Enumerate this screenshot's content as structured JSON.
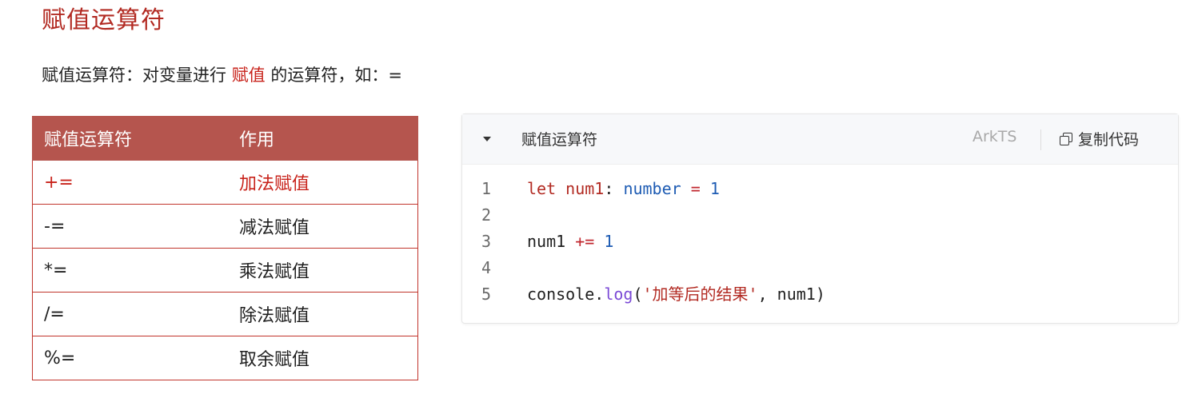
{
  "page": {
    "title": "赋值运算符",
    "intro_prefix": "赋值运算符：对变量进行 ",
    "intro_highlight": "赋值",
    "intro_suffix": " 的运算符，如：="
  },
  "table": {
    "headers": [
      "赋值运算符",
      "作用"
    ],
    "rows": [
      {
        "operator": "+=",
        "meaning": "加法赋值",
        "highlighted": true
      },
      {
        "operator": "-=",
        "meaning": "减法赋值",
        "highlighted": false
      },
      {
        "operator": "*=",
        "meaning": "乘法赋值",
        "highlighted": false
      },
      {
        "operator": "/=",
        "meaning": "除法赋值",
        "highlighted": false
      },
      {
        "operator": "%=",
        "meaning": "取余赋值",
        "highlighted": false
      }
    ]
  },
  "code_block": {
    "title": "赋值运算符",
    "language": "ArkTS",
    "copy_label": "复制代码",
    "line_numbers": [
      "1",
      "2",
      "3",
      "4",
      "5"
    ],
    "lines": [
      [
        {
          "t": "let",
          "k": "kw"
        },
        {
          "t": " ",
          "k": ""
        },
        {
          "t": "num1",
          "k": "var"
        },
        {
          "t": ": ",
          "k": ""
        },
        {
          "t": "number",
          "k": "type"
        },
        {
          "t": " ",
          "k": ""
        },
        {
          "t": "=",
          "k": "op"
        },
        {
          "t": " ",
          "k": ""
        },
        {
          "t": "1",
          "k": "num"
        }
      ],
      [],
      [
        {
          "t": "num1",
          "k": ""
        },
        {
          "t": " ",
          "k": ""
        },
        {
          "t": "+=",
          "k": "op"
        },
        {
          "t": " ",
          "k": ""
        },
        {
          "t": "1",
          "k": "num"
        }
      ],
      [],
      [
        {
          "t": "console.",
          "k": ""
        },
        {
          "t": "log",
          "k": "fn"
        },
        {
          "t": "(",
          "k": ""
        },
        {
          "t": "'加等后的结果'",
          "k": "str"
        },
        {
          "t": ", num1)",
          "k": ""
        }
      ]
    ]
  },
  "colors": {
    "title_red": "#b22a22",
    "table_header_bg": "#b5554e",
    "table_border": "#c1352c",
    "code_header_bg": "#f7f8fa"
  },
  "icons": [
    "caret-down-icon",
    "copy-icon"
  ]
}
